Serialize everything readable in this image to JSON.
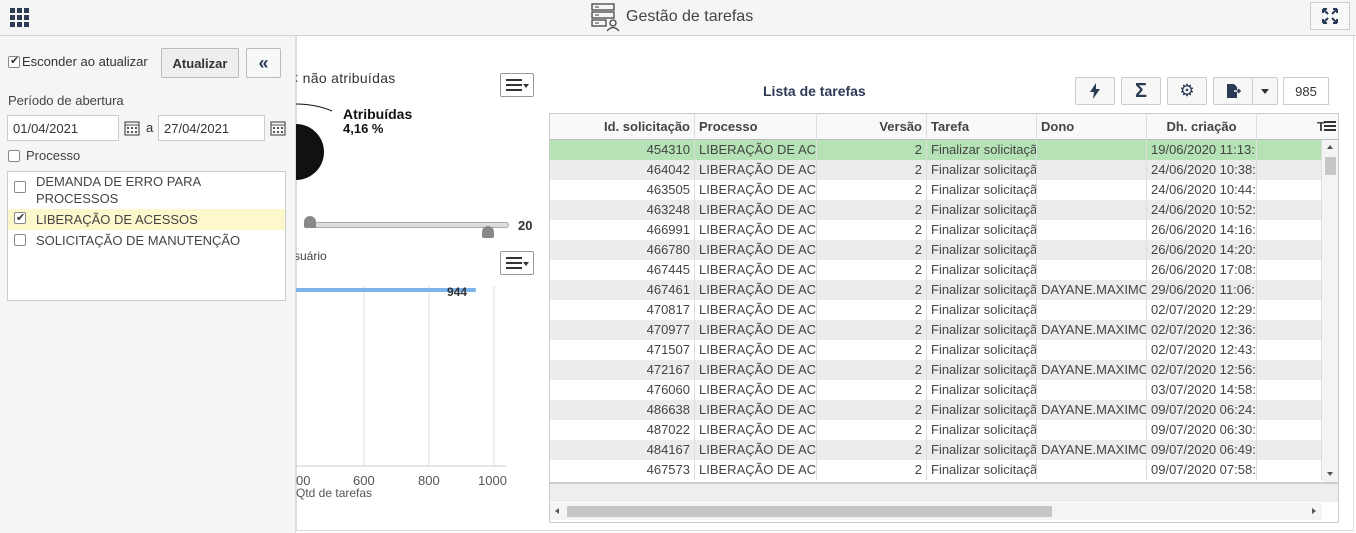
{
  "app": {
    "title": "Gestão de tarefas"
  },
  "filter": {
    "hide_on_update_label": "Esconder ao atualizar",
    "update_button": "Atualizar",
    "collapse_button": "«",
    "period_label": "Período de abertura",
    "date_from": "01/04/2021",
    "date_separator": "a",
    "date_to": "27/04/2021",
    "process_label": "Processo",
    "processes": [
      {
        "label": "DEMANDA DE ERRO PARA PROCESSOS",
        "checked": false
      },
      {
        "label": "LIBERAÇÃO DE ACESSOS",
        "checked": true
      },
      {
        "label": "SOLICITAÇÃO DE MANUTENÇÃO",
        "checked": false
      }
    ]
  },
  "charts": {
    "pie_legend": "< não atribuídas",
    "pie_label": "Atribuídas",
    "pie_percent": "4,16 %",
    "slider_value": "20",
    "bar_title": "suário",
    "bar_value_label": "944",
    "x_ticks": [
      "00",
      "600",
      "800",
      "1000"
    ],
    "x_title": "Qtd de tarefas"
  },
  "chart_data": {
    "type": "bar",
    "categories": [
      ""
    ],
    "values": [
      944
    ],
    "xlabel": "Qtd de tarefas",
    "xlim": [
      400,
      1000
    ]
  },
  "task_list": {
    "title": "Lista de tarefas",
    "count": "985",
    "columns": [
      "Id. solicitação",
      "Processo",
      "Versão",
      "Tarefa",
      "Dono",
      "Dh. criação",
      "T"
    ],
    "rows": [
      [
        "454310",
        "LIBERAÇÃO DE AC",
        "2",
        "Finalizar solicitaçã",
        "",
        "19/06/2020 11:13:"
      ],
      [
        "464042",
        "LIBERAÇÃO DE AC",
        "2",
        "Finalizar solicitaçã",
        "",
        "24/06/2020 10:38:"
      ],
      [
        "463505",
        "LIBERAÇÃO DE AC",
        "2",
        "Finalizar solicitaçã",
        "",
        "24/06/2020 10:44:"
      ],
      [
        "463248",
        "LIBERAÇÃO DE AC",
        "2",
        "Finalizar solicitaçã",
        "",
        "24/06/2020 10:52:"
      ],
      [
        "466991",
        "LIBERAÇÃO DE AC",
        "2",
        "Finalizar solicitaçã",
        "",
        "26/06/2020 14:16:"
      ],
      [
        "466780",
        "LIBERAÇÃO DE AC",
        "2",
        "Finalizar solicitaçã",
        "",
        "26/06/2020 14:20:"
      ],
      [
        "467445",
        "LIBERAÇÃO DE AC",
        "2",
        "Finalizar solicitaçã",
        "",
        "26/06/2020 17:08:"
      ],
      [
        "467461",
        "LIBERAÇÃO DE AC",
        "2",
        "Finalizar solicitaçã",
        "DAYANE.MAXIMO",
        "29/06/2020 11:06:"
      ],
      [
        "470817",
        "LIBERAÇÃO DE AC",
        "2",
        "Finalizar solicitaçã",
        "",
        "02/07/2020 12:29:"
      ],
      [
        "470977",
        "LIBERAÇÃO DE AC",
        "2",
        "Finalizar solicitaçã",
        "DAYANE.MAXIMO",
        "02/07/2020 12:36:"
      ],
      [
        "471507",
        "LIBERAÇÃO DE AC",
        "2",
        "Finalizar solicitaçã",
        "",
        "02/07/2020 12:43:"
      ],
      [
        "472167",
        "LIBERAÇÃO DE AC",
        "2",
        "Finalizar solicitaçã",
        "DAYANE.MAXIMO",
        "02/07/2020 12:56:"
      ],
      [
        "476060",
        "LIBERAÇÃO DE AC",
        "2",
        "Finalizar solicitaçã",
        "",
        "03/07/2020 14:58:"
      ],
      [
        "486638",
        "LIBERAÇÃO DE AC",
        "2",
        "Finalizar solicitaçã",
        "DAYANE.MAXIMO",
        "09/07/2020 06:24:"
      ],
      [
        "487022",
        "LIBERAÇÃO DE AC",
        "2",
        "Finalizar solicitaçã",
        "",
        "09/07/2020 06:30:"
      ],
      [
        "484167",
        "LIBERAÇÃO DE AC",
        "2",
        "Finalizar solicitaçã",
        "DAYANE.MAXIMO",
        "09/07/2020 06:49:"
      ],
      [
        "467573",
        "LIBERAÇÃO DE AC",
        "2",
        "Finalizar solicitaçã",
        "",
        "09/07/2020 07:58:"
      ]
    ]
  },
  "colors": {
    "accent": "#2b3a55",
    "highlight_row": "#b5e3b5",
    "selected_process": "#fdf7cc",
    "bar": "#7cb5ec"
  }
}
